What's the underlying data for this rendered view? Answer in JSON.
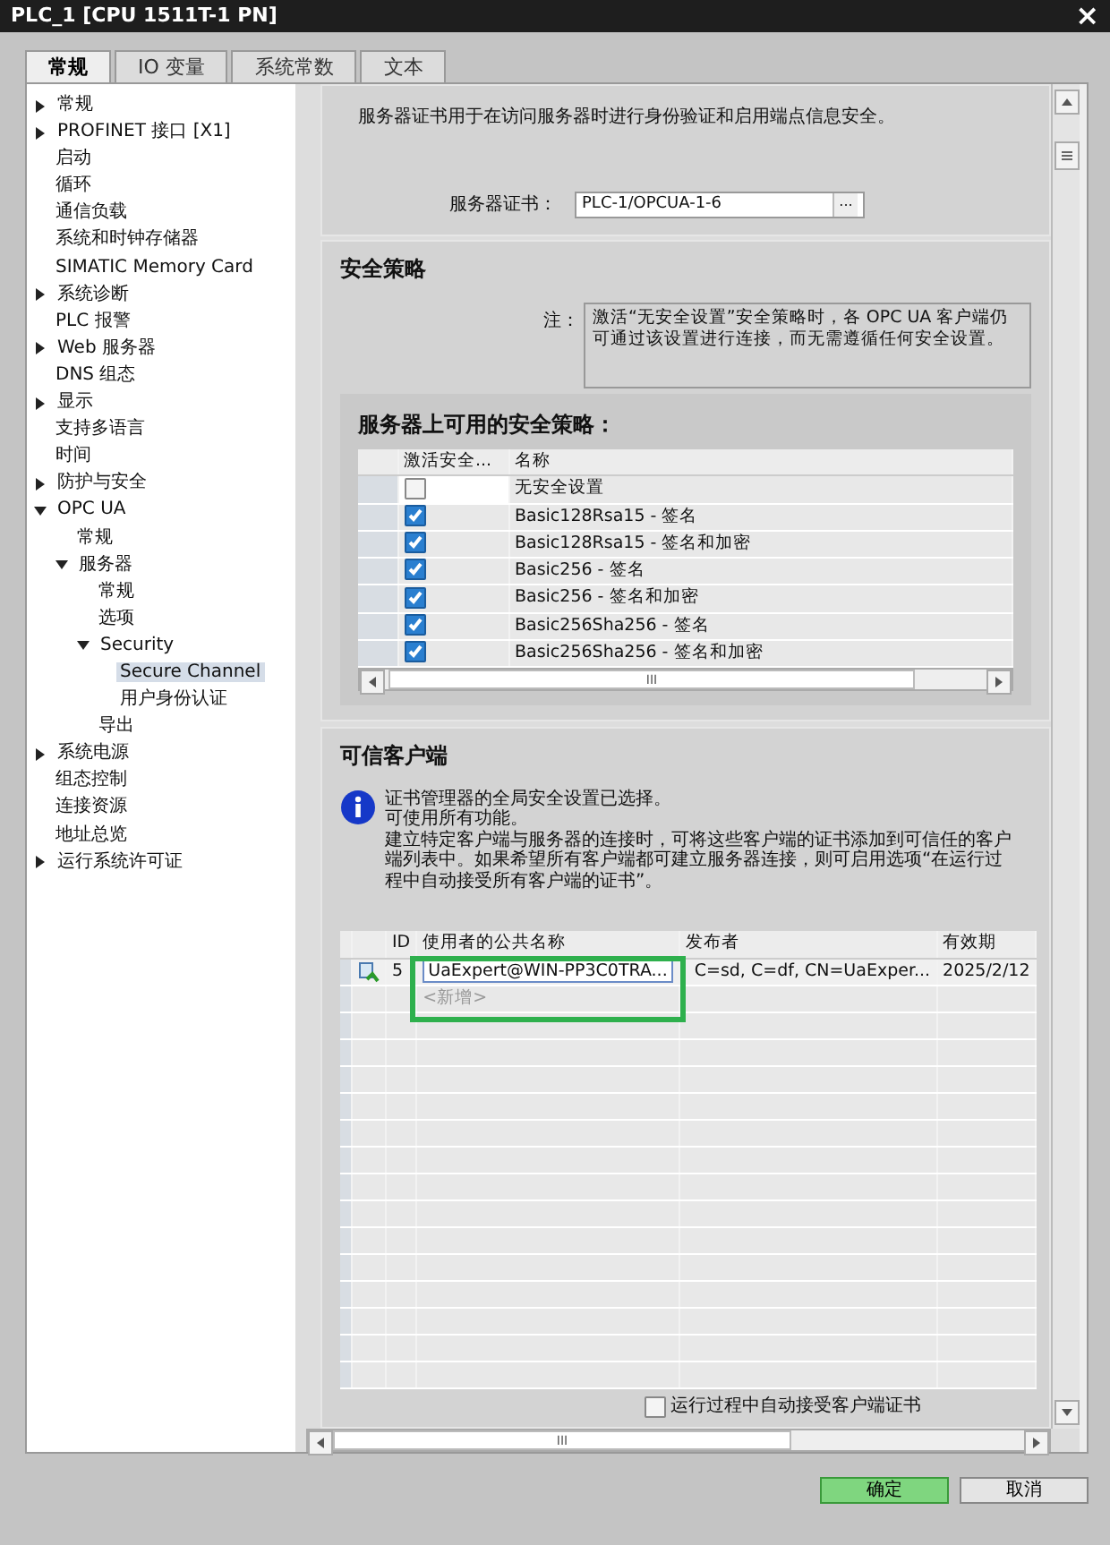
{
  "window": {
    "title": "PLC_1 [CPU 1511T-1 PN]",
    "close": "×"
  },
  "tabs": [
    {
      "label": "常规",
      "selected": true
    },
    {
      "label": "IO 变量",
      "selected": false
    },
    {
      "label": "系统常数",
      "selected": false
    },
    {
      "label": "文本",
      "selected": false
    }
  ],
  "tree": [
    {
      "label": "常规",
      "expanded": false,
      "selected": false
    },
    {
      "label": "PROFINET 接口 [X1]",
      "expanded": false,
      "selected": false
    },
    {
      "label": "启动",
      "selected": false
    },
    {
      "label": "循环",
      "selected": false
    },
    {
      "label": "通信负载",
      "selected": false
    },
    {
      "label": "系统和时钟存储器",
      "selected": false
    },
    {
      "label": "SIMATIC Memory Card",
      "selected": false
    },
    {
      "label": "系统诊断",
      "expanded": false,
      "selected": false
    },
    {
      "label": "PLC 报警",
      "selected": false
    },
    {
      "label": "Web 服务器",
      "expanded": false,
      "selected": false
    },
    {
      "label": "DNS 组态",
      "selected": false
    },
    {
      "label": "显示",
      "expanded": false,
      "selected": false
    },
    {
      "label": "支持多语言",
      "selected": false
    },
    {
      "label": "时间",
      "selected": false
    },
    {
      "label": "防护与安全",
      "expanded": false,
      "selected": false
    },
    {
      "label": "OPC UA",
      "expanded": true,
      "selected": false,
      "children": [
        {
          "label": "常规",
          "selected": false
        },
        {
          "label": "服务器",
          "expanded": true,
          "selected": false,
          "children": [
            {
              "label": "常规",
              "selected": false
            },
            {
              "label": "选项",
              "selected": false
            },
            {
              "label": "Security",
              "expanded": true,
              "selected": false,
              "children": [
                {
                  "label": "Secure Channel",
                  "selected": true
                },
                {
                  "label": "用户身份认证",
                  "selected": false
                }
              ]
            },
            {
              "label": "导出",
              "selected": false
            }
          ]
        }
      ]
    },
    {
      "label": "系统电源",
      "expanded": false,
      "selected": false
    },
    {
      "label": "组态控制",
      "selected": false
    },
    {
      "label": "连接资源",
      "selected": false
    },
    {
      "label": "地址总览",
      "selected": false
    },
    {
      "label": "运行系统许可证",
      "expanded": false,
      "selected": false
    }
  ],
  "certificate": {
    "description": "服务器证书用于在访问服务器时进行身份验证和启用端点信息安全。",
    "label": "服务器证书：",
    "value": "PLC-1/OPCUA-1-6",
    "browse": "..."
  },
  "security_policy": {
    "heading": "安全策略",
    "note_label": "注：",
    "note": "激活“无安全设置”安全策略时，各 OPC UA 客户端仍可通过该设置进行连接，而无需遵循任何安全设置。",
    "available_heading": "服务器上可用的安全策略：",
    "columns": [
      "激活安全...",
      "名称"
    ],
    "rows": [
      {
        "checked": false,
        "name": "无安全设置"
      },
      {
        "checked": true,
        "name": "Basic128Rsa15 - 签名"
      },
      {
        "checked": true,
        "name": "Basic128Rsa15 - 签名和加密"
      },
      {
        "checked": true,
        "name": "Basic256 - 签名"
      },
      {
        "checked": true,
        "name": "Basic256 - 签名和加密"
      },
      {
        "checked": true,
        "name": "Basic256Sha256 - 签名"
      },
      {
        "checked": true,
        "name": "Basic256Sha256 - 签名和加密"
      }
    ],
    "scroll_mark": "III"
  },
  "trusted_clients": {
    "heading": "可信客户端",
    "info": [
      "证书管理器的全局安全设置已选择。",
      "可使用所有功能。",
      "建立特定客户端与服务器的连接时，可将这些客户端的证书添加到可信任的客户端列表中。如果希望所有客户端都可建立服务器连接，则可启用选项“在运行过程中自动接受所有客户端的证书”。"
    ],
    "columns": [
      "ID",
      "使用者的公共名称",
      "发布者",
      "有效期"
    ],
    "rows": [
      {
        "id": "5",
        "subject": "UaExpert@WIN-PP3C0TRA...",
        "issuer": "C=sd, C=df, CN=UaExper...",
        "valid": "2025/2/12"
      }
    ],
    "new_row": "<新增>",
    "highlight_box": true,
    "auto_accept": {
      "label": "运行过程中自动接受客户端证书",
      "checked": false
    }
  },
  "hscroll_mark": "III",
  "buttons": [
    {
      "label": "确定",
      "primary": true
    },
    {
      "label": "取消",
      "primary": false
    }
  ]
}
